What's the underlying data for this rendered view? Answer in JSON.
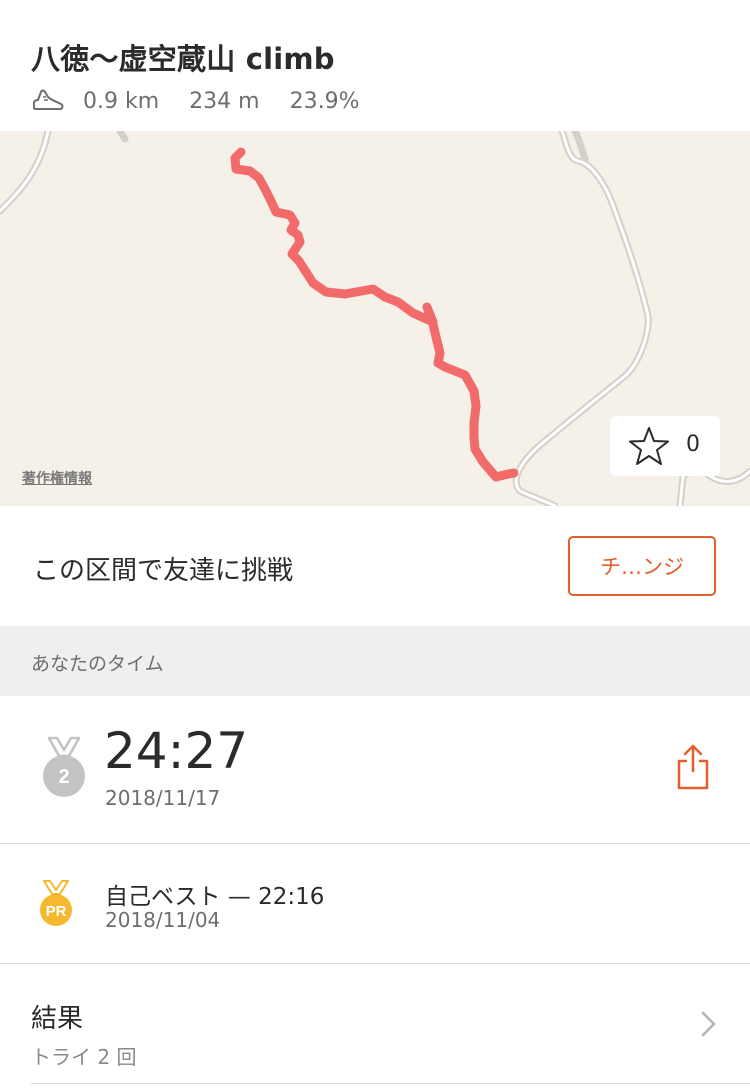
{
  "segment": {
    "title": "八徳〜虚空蔵山 climb",
    "distance": "0.9 km",
    "elevation": "234 m",
    "grade": "23.9%"
  },
  "map": {
    "attribution": "著作権情報",
    "star_count": "0",
    "route_color": "#f26b6b"
  },
  "challenge": {
    "text": "この区間で友達に挑戦",
    "button_label": "チ…ンジ"
  },
  "your_time": {
    "section_label": "あなたのタイム",
    "rank": "2",
    "time": "24:27",
    "date": "2018/11/17"
  },
  "personal_best": {
    "badge": "PR",
    "label": "自己ベスト — 22:16",
    "date": "2018/11/04"
  },
  "results": {
    "title": "結果",
    "subtitle": "トライ 2 回"
  },
  "colors": {
    "accent": "#e35f2c",
    "gold": "#f5b82e",
    "silver": "#c4c4c4",
    "section_bg": "#efefef",
    "map_bg": "#f6f1e8"
  },
  "icons": {
    "stats": "shoe-icon",
    "favorite": "star-icon",
    "share": "share-icon",
    "more": "chevron-right-icon"
  }
}
